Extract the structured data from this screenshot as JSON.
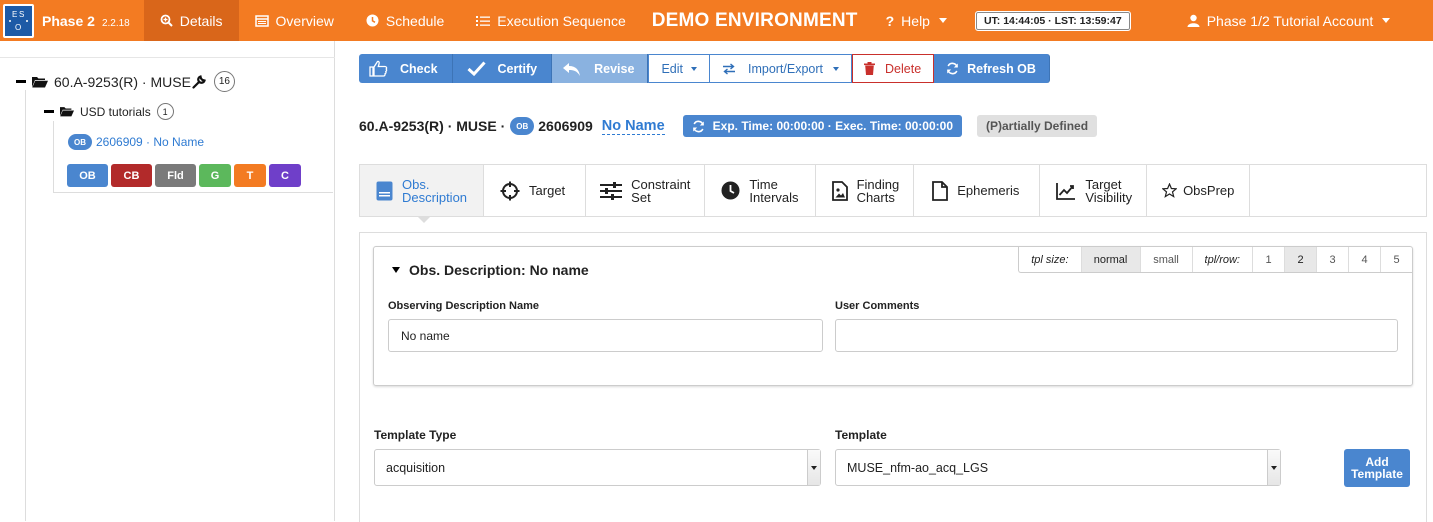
{
  "navbar": {
    "brand": "Phase 2",
    "version": "2.2.18",
    "items": [
      {
        "label": "Details",
        "icon": "search-icon"
      },
      {
        "label": "Overview",
        "icon": "list-window-icon"
      },
      {
        "label": "Schedule",
        "icon": "clock-icon"
      },
      {
        "label": "Execution Sequence",
        "icon": "list-icon"
      }
    ],
    "environment": "DEMO ENVIRONMENT",
    "help": "Help",
    "clock": "UT: 14:44:05 · LST: 13:59:47",
    "account": "Phase 1/2 Tutorial Account",
    "accent": "#f37b22"
  },
  "tree": {
    "root_label": "60.A-9253(R) · MUSE",
    "root_count": "16",
    "folder_label": "USD tutorials",
    "folder_count": "1",
    "ob_badge": "OB",
    "ob_label": "2606909 · No Name",
    "chips": [
      {
        "label": "OB",
        "color": "#4a86cf"
      },
      {
        "label": "CB",
        "color": "#b22a2a"
      },
      {
        "label": "Fld",
        "color": "#7a7a7a"
      },
      {
        "label": "G",
        "color": "#5cb85c"
      },
      {
        "label": "T",
        "color": "#f37b22"
      },
      {
        "label": "C",
        "color": "#6f3fc9"
      }
    ]
  },
  "toolbar": {
    "check": "Check",
    "certify": "Certify",
    "revise": "Revise",
    "edit": "Edit",
    "import_export": "Import/Export",
    "delete": "Delete",
    "refresh": "Refresh OB"
  },
  "ob_header": {
    "run": "60.A-9253(R) · MUSE ·",
    "badge": "OB",
    "id": "2606909",
    "name": "No Name",
    "times": "Exp. Time: 00:00:00 · Exec. Time: 00:00:00",
    "status": "(P)artially Defined"
  },
  "tabs": [
    {
      "line1": "Obs.",
      "line2": "Description",
      "icon": "document-icon"
    },
    {
      "line1": "Target",
      "line2": "",
      "icon": "crosshair-icon"
    },
    {
      "line1": "Constraint",
      "line2": "Set",
      "icon": "sliders-icon"
    },
    {
      "line1": "Time",
      "line2": "Intervals",
      "icon": "clock-icon"
    },
    {
      "line1": "Finding",
      "line2": "Charts",
      "icon": "image-file-icon"
    },
    {
      "line1": "Ephemeris",
      "line2": "",
      "icon": "file-icon"
    },
    {
      "line1": "Target",
      "line2": "Visibility",
      "icon": "line-chart-icon"
    },
    {
      "line1": "ObsPrep",
      "line2": "",
      "icon": "star-icon"
    }
  ],
  "obs_desc": {
    "title": "Obs. Description: No name",
    "tpl_size_label": "tpl size:",
    "sizes": [
      "normal",
      "small"
    ],
    "tpl_row_label": "tpl/row:",
    "rows": [
      "1",
      "2",
      "3",
      "4",
      "5"
    ],
    "name_label": "Observing Description Name",
    "name_value": "No name",
    "comments_label": "User Comments",
    "comments_value": ""
  },
  "template": {
    "type_label": "Template Type",
    "type_value": "acquisition",
    "template_label": "Template",
    "template_value": "MUSE_nfm-ao_acq_LGS",
    "add_line1": "Add",
    "add_line2": "Template"
  }
}
